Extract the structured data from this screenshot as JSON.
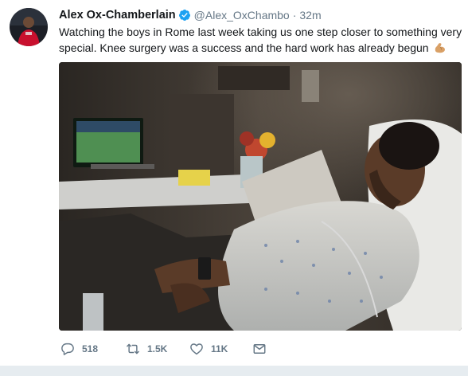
{
  "tweet": {
    "author_name": "Alex Ox-Chamberlain",
    "author_handle": "@Alex_OxChambo",
    "separator": "·",
    "time": "32m",
    "text": "Watching the boys in Rome last week taking us one step closer to something very special. Knee surgery was a success and the hard work has already begun",
    "emoji": "flexed-biceps-emoji",
    "photo_description_icon": "hospital-bed-photo"
  },
  "actions": {
    "reply_count": "518",
    "retweet_count": "1.5K",
    "like_count": "11K"
  },
  "colors": {
    "verified": "#1da1f2",
    "muted": "#657786",
    "text": "#14171a",
    "background": "#e6ecf0"
  }
}
